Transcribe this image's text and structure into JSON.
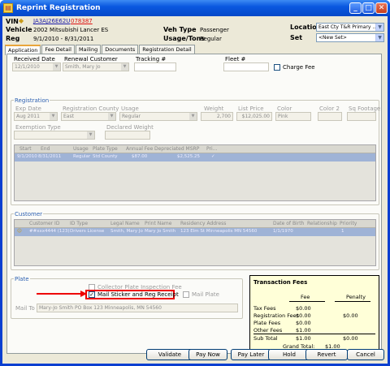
{
  "window": {
    "title": "Reprint Registration"
  },
  "header": {
    "vin_label": "VIN",
    "vin_value": "JA3AJ26E62U",
    "vin_suffix": "078387",
    "vehicle_label": "Vehicle",
    "vehicle_value": "2002 Mitsubishi Lancer ES",
    "reg_label": "Reg",
    "reg_value": "9/1/2010 - 8/31/2011",
    "vehtype_label": "Veh Type",
    "vehtype_value": "Passenger",
    "usage_label": "Usage/Tons",
    "usage_value": "Regular",
    "location_label": "Location",
    "location_value": "East Cty T&R Primary ...",
    "set_label": "Set",
    "set_value": "<New Set>"
  },
  "tabs": [
    "Application",
    "Fee Detail",
    "Mailing",
    "Documents",
    "Registration Detail"
  ],
  "application": {
    "received_label": "Received Date",
    "received_value": "12/1/2010",
    "renewal_label": "Renewal Customer",
    "renewal_value": "Smith, Mary Jo",
    "tracking_label": "Tracking #",
    "tracking_value": "",
    "fleet_label": "Fleet #",
    "fleet_value": "",
    "charge_fee_label": "Charge Fee"
  },
  "registration": {
    "title": "Registration",
    "exp_label": "Exp Date",
    "exp_value": "Aug 2011",
    "county_label": "Registration County",
    "county_value": "East",
    "usage_label": "Usage",
    "usage_value": "Regular",
    "weight_label": "Weight",
    "weight_value": "2,700",
    "list_label": "List Price",
    "list_value": "$12,025.00",
    "color_label": "Color",
    "color_value": "Pink",
    "color2_label": "Color 2",
    "color2_value": "",
    "sqft_label": "Sq Footage",
    "sqft_value": "",
    "exemption_label": "Exemption Type",
    "exemption_value": "",
    "declared_label": "Declared Weight",
    "declared_value": "",
    "grid_headers": [
      "Start",
      "End",
      "Usage",
      "Plate Type",
      "Annual Fee",
      "Depreciated MSRP",
      "Pri..."
    ],
    "grid_row": [
      "9/1/2010",
      "8/31/2011",
      "Regular",
      "Std County",
      "$87.00",
      "$2,525.25",
      "✓"
    ]
  },
  "customer": {
    "title": "Customer",
    "grid_headers": [
      "Customer ID",
      "ID Type",
      "Legal Name",
      "Print Name",
      "Residency Address",
      "Date of Birth",
      "Relationship",
      "Priority"
    ],
    "grid_row": [
      "##xxx4444 (123)",
      "Drivers License",
      "Smith, Mary Jo",
      "Mary Jo Smith",
      "123 Elm St Minneapolis MN 54560",
      "1/1/1970",
      "",
      "1"
    ]
  },
  "plate": {
    "title": "Plate",
    "collector_label": "Collector Plate Inspection Fee",
    "mail_sticker_label": "Mail Sticker and Reg Receipt",
    "mail_plate_label": "Mail Plate",
    "mailto_label": "Mail To",
    "mailto_value": "Mary-Jo Smith PO Box 123 Minneapolis, MN 54560"
  },
  "fees": {
    "title": "Transaction Fees",
    "col_fee": "Fee",
    "col_penalty": "Penalty",
    "rows": [
      {
        "label": "Tax Fees",
        "fee": "$0.00",
        "penalty": ""
      },
      {
        "label": "Registration Fees",
        "fee": "$0.00",
        "penalty": "$0.00"
      },
      {
        "label": "Plate Fees",
        "fee": "$0.00",
        "penalty": ""
      },
      {
        "label": "Other Fees",
        "fee": "$1.00",
        "penalty": ""
      }
    ],
    "subtotal_label": "Sub Total",
    "subtotal_fee": "$1.00",
    "subtotal_penalty": "$0.00",
    "grand_label": "Grand Total:",
    "grand_value": "$1.00"
  },
  "buttons": {
    "validate": "Validate",
    "paynow": "Pay Now",
    "paylater": "Pay Later",
    "hold": "Hold",
    "revert": "Revert",
    "cancel": "Cancel"
  }
}
